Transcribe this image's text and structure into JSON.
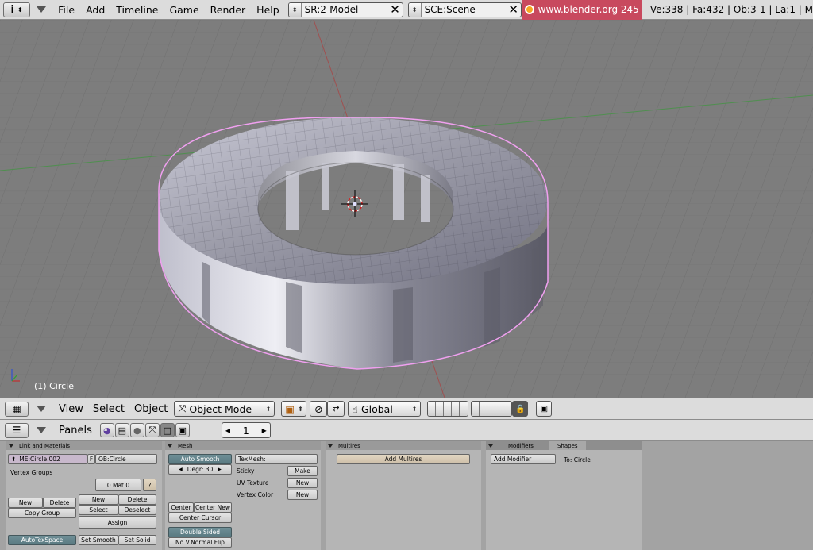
{
  "top": {
    "info_icon": "i",
    "menus": [
      "File",
      "Add",
      "Timeline",
      "Game",
      "Render",
      "Help"
    ],
    "screen": "SR:2-Model",
    "scene": "SCE:Scene",
    "url": "www.blender.org 245",
    "stats": "Ve:338 | Fa:432 | Ob:3-1 | La:1  | M"
  },
  "viewport": {
    "object_label": "(1) Circle",
    "colors": {
      "background": "#7d7d7d",
      "grid": "#6f6f6f",
      "x_axis": "#a05050",
      "y_axis": "#4f8f4f",
      "selection": "#f0a0f0"
    }
  },
  "view_header": {
    "menus": [
      "View",
      "Select",
      "Object"
    ],
    "mode": "Object Mode",
    "orientation": "Global"
  },
  "buttons_header": {
    "panels_label": "Panels",
    "frame": "1"
  },
  "panels": {
    "link_materials": {
      "title": "Link and Materials",
      "mesh_name": "ME:Circle.002",
      "f_label": "F",
      "object_name": "OB:Circle",
      "vertex_groups": "Vertex Groups",
      "mat_index": "0 Mat 0",
      "help": "?",
      "new": "New",
      "delete": "Delete",
      "copy_group": "Copy Group",
      "new2": "New",
      "delete2": "Delete",
      "select": "Select",
      "deselect": "Deselect",
      "assign": "Assign",
      "autotexspace": "AutoTexSpace",
      "set_smooth": "Set Smooth",
      "set_solid": "Set Solid"
    },
    "mesh": {
      "title": "Mesh",
      "auto_smooth": "Auto Smooth",
      "degr": "Degr: 30",
      "texmesh": "TexMesh:",
      "sticky": "Sticky",
      "make": "Make",
      "uv_texture": "UV Texture",
      "new_uv": "New",
      "vertex_color": "Vertex Color",
      "new_vc": "New",
      "center": "Center",
      "center_new": "Center New",
      "center_cursor": "Center Cursor",
      "double_sided": "Double Sided",
      "no_vnormal_flip": "No V.Normal Flip"
    },
    "multires": {
      "title": "Multires",
      "add_multires": "Add Multires"
    },
    "modifiers": {
      "tab_modifiers": "Modifiers",
      "tab_shapes": "Shapes",
      "add_modifier": "Add Modifier",
      "to_label": "To: Circle"
    }
  }
}
